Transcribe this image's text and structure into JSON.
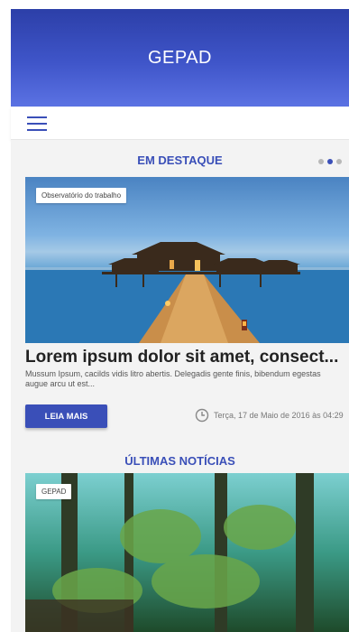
{
  "app": {
    "title": "GEPAD"
  },
  "featured": {
    "section_title": "EM DESTAQUE",
    "tag": "Observatório do trabalho",
    "headline": "Lorem ipsum dolor sit amet, consect...",
    "excerpt": "Mussum Ipsum, cacilds vidis litro abertis. Delegadis gente finis, bibendum egestas augue arcu ut est...",
    "button_label": "LEIA MAIS",
    "date": "Terça, 17 de Maio de 2016 às 04:29",
    "carousel": {
      "count": 3,
      "active": 2
    }
  },
  "latest": {
    "section_title": "ÚLTIMAS NOTÍCIAS",
    "tag": "GEPAD"
  },
  "icons": {
    "menu": "menu-icon",
    "clock": "clock-icon"
  },
  "colors": {
    "primary": "#3a4fb8",
    "app_bar": "#3f55c9",
    "background": "#f3f3f3"
  }
}
